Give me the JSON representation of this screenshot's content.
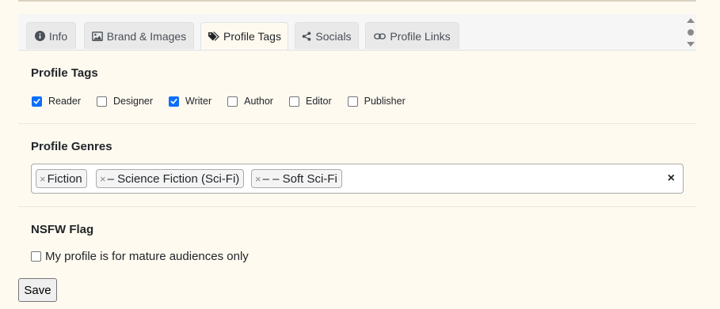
{
  "tabs": [
    {
      "label": "Info",
      "icon": "info-circle-icon"
    },
    {
      "label": "Brand & Images",
      "icon": "image-icon"
    },
    {
      "label": "Profile Tags",
      "icon": "tags-icon",
      "active": true
    },
    {
      "label": "Socials",
      "icon": "share-icon"
    },
    {
      "label": "Profile Links",
      "icon": "link-icon"
    }
  ],
  "profile_tags": {
    "title": "Profile Tags",
    "options": [
      {
        "label": "Reader",
        "checked": true
      },
      {
        "label": "Designer",
        "checked": false
      },
      {
        "label": "Writer",
        "checked": true
      },
      {
        "label": "Author",
        "checked": false
      },
      {
        "label": "Editor",
        "checked": false
      },
      {
        "label": "Publisher",
        "checked": false
      }
    ]
  },
  "profile_genres": {
    "title": "Profile Genres",
    "chips": [
      {
        "remove": "×",
        "label": "Fiction"
      },
      {
        "remove": "×",
        "label": "– Science Fiction (Sci-Fi)"
      },
      {
        "remove": "×",
        "label": "– – Soft Sci-Fi"
      }
    ],
    "clear": "×"
  },
  "nsfw": {
    "title": "NSFW Flag",
    "label": "My profile is for mature audiences only",
    "checked": false
  },
  "save_label": "Save",
  "colors": {
    "accent": "#0d6efd",
    "background": "#fffaf0"
  }
}
